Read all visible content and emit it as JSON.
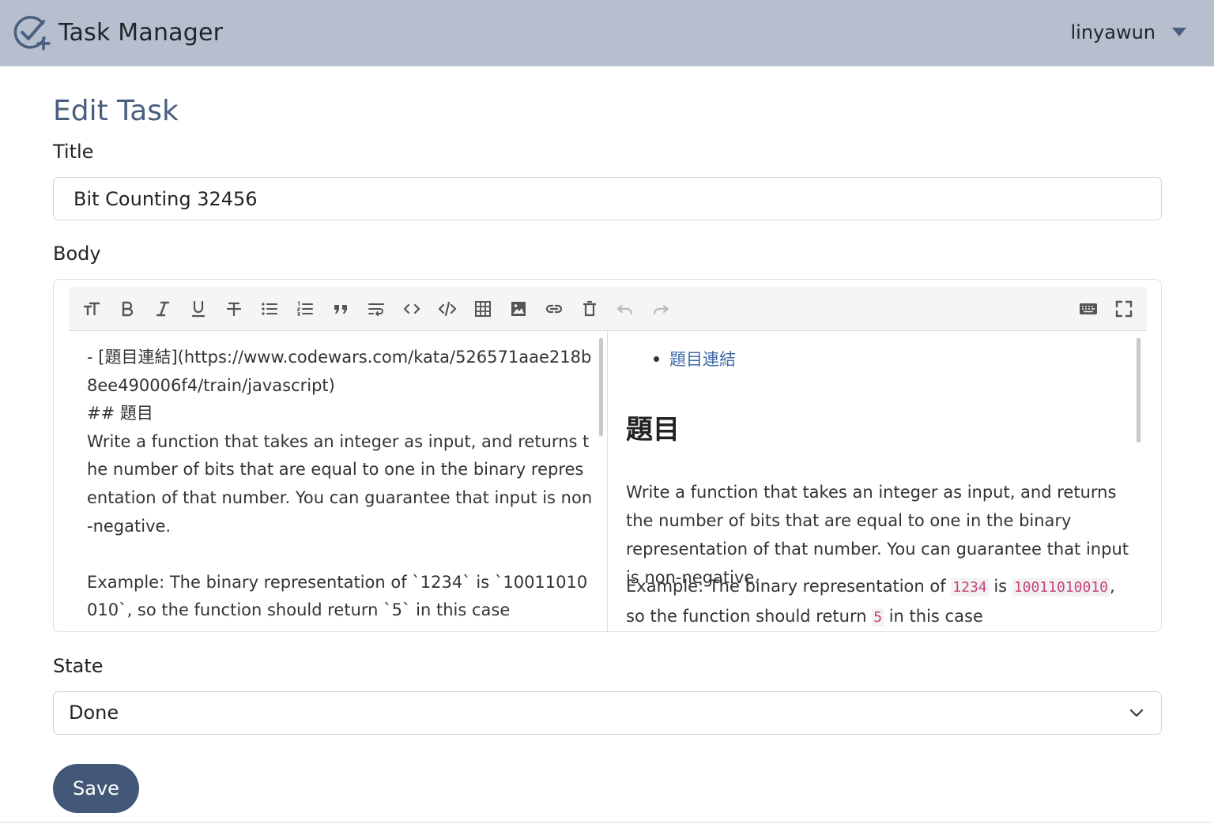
{
  "navbar": {
    "brand": "Task Manager",
    "brand_icon": "check-circle-plus-icon",
    "user": "linyawun"
  },
  "page": {
    "heading": "Edit Task",
    "title_label": "Title",
    "title_value": "Bit Counting 32456",
    "body_label": "Body",
    "state_label": "State",
    "state_value": "Done",
    "save_label": "Save"
  },
  "editor": {
    "toolbar": [
      "heading-icon",
      "bold-icon",
      "italic-icon",
      "underline-icon",
      "strikethrough-icon",
      "bullet-list-icon",
      "ordered-list-icon",
      "quote-icon",
      "wrap-icon",
      "inline-code-icon",
      "code-block-icon",
      "table-icon",
      "image-icon",
      "link-icon",
      "clear-icon",
      "undo-icon",
      "redo-icon",
      "keyboard-icon",
      "fullscreen-icon"
    ],
    "source_text": "- [題目連結](https://www.codewars.com/kata/526571aae218b8ee490006f4/train/javascript)\n## 題目\nWrite a function that takes an integer as input, and returns the number of bits that are equal to one in the binary representation of that number. You can guarantee that input is non-negative.\n\nExample: The binary representation of `1234` is `10011010010`, so the function should return `5` in this case",
    "preview": {
      "link_text": "題目連結",
      "heading": "題目",
      "paragraph1": "Write a function that takes an integer as input, and returns the number of bits that are equal to one in the binary representation of that number. You can guarantee that input is non-negative.",
      "p2_a": "Example: The binary representation of ",
      "p2_code1": "1234",
      "p2_b": " is ",
      "p2_code2": "10011010010",
      "p2_c": ", so the function should return ",
      "p2_code3": "5",
      "p2_d": " in this case"
    }
  },
  "colors": {
    "navbar_bg": "#b7bfce",
    "heading": "#4a5f80",
    "save_button": "#435779",
    "link": "#3f6aa8",
    "inline_code": "#c7427a"
  }
}
